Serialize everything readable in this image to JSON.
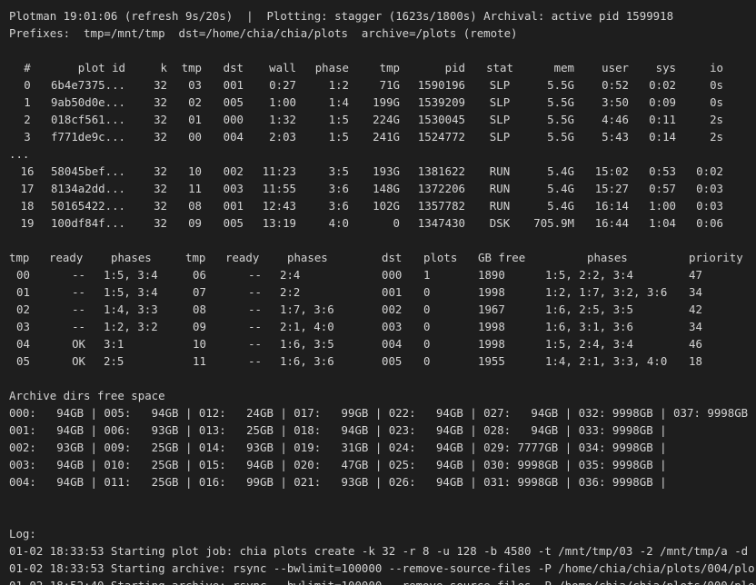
{
  "header": {
    "line1": "Plotman 19:01:06 (refresh 9s/20s)  |  Plotting: stagger (1623s/1800s) Archival: active pid 1599918",
    "line2": "Prefixes:  tmp=/mnt/tmp  dst=/home/chia/chia/plots  archive=/plots (remote)"
  },
  "jobs": {
    "columns": [
      "#",
      "plot id",
      "k",
      "tmp",
      "dst",
      "wall",
      "phase",
      "tmp",
      "pid",
      "stat",
      "mem",
      "user",
      "sys",
      "io"
    ],
    "rows_top": [
      [
        "0",
        "6b4e7375...",
        "32",
        "03",
        "001",
        "0:27",
        "1:2",
        "71G",
        "1590196",
        "SLP",
        "5.5G",
        "0:52",
        "0:02",
        "0s"
      ],
      [
        "1",
        "9ab50d0e...",
        "32",
        "02",
        "005",
        "1:00",
        "1:4",
        "199G",
        "1539209",
        "SLP",
        "5.5G",
        "3:50",
        "0:09",
        "0s"
      ],
      [
        "2",
        "018cf561...",
        "32",
        "01",
        "000",
        "1:32",
        "1:5",
        "224G",
        "1530045",
        "SLP",
        "5.5G",
        "4:46",
        "0:11",
        "2s"
      ],
      [
        "3",
        "f771de9c...",
        "32",
        "00",
        "004",
        "2:03",
        "1:5",
        "241G",
        "1524772",
        "SLP",
        "5.5G",
        "5:43",
        "0:14",
        "2s"
      ]
    ],
    "ellipsis": "...",
    "rows_bottom": [
      [
        "16",
        "58045bef...",
        "32",
        "10",
        "002",
        "11:23",
        "3:5",
        "193G",
        "1381622",
        "RUN",
        "5.4G",
        "15:02",
        "0:53",
        "0:02"
      ],
      [
        "17",
        "8134a2dd...",
        "32",
        "11",
        "003",
        "11:55",
        "3:6",
        "148G",
        "1372206",
        "RUN",
        "5.4G",
        "15:27",
        "0:57",
        "0:03"
      ],
      [
        "18",
        "50165422...",
        "32",
        "08",
        "001",
        "12:43",
        "3:6",
        "102G",
        "1357782",
        "RUN",
        "5.4G",
        "16:14",
        "1:00",
        "0:03"
      ],
      [
        "19",
        "100df84f...",
        "32",
        "09",
        "005",
        "13:19",
        "4:0",
        "0",
        "1347430",
        "DSK",
        "705.9M",
        "16:44",
        "1:04",
        "0:06"
      ]
    ]
  },
  "tmp_dst": {
    "columns": [
      "tmp",
      "ready",
      "phases",
      "tmp",
      "ready",
      "phases",
      "dst",
      "plots",
      "GB free",
      "phases",
      "priority"
    ],
    "rows": [
      [
        "00",
        "--",
        "1:5, 3:4",
        "06",
        "--",
        "2:4",
        "000",
        "1",
        "1890",
        "1:5, 2:2, 3:4",
        "47"
      ],
      [
        "01",
        "--",
        "1:5, 3:4",
        "07",
        "--",
        "2:2",
        "001",
        "0",
        "1998",
        "1:2, 1:7, 3:2, 3:6",
        "34"
      ],
      [
        "02",
        "--",
        "1:4, 3:3",
        "08",
        "--",
        "1:7, 3:6",
        "002",
        "0",
        "1967",
        "1:6, 2:5, 3:5",
        "42"
      ],
      [
        "03",
        "--",
        "1:2, 3:2",
        "09",
        "--",
        "2:1, 4:0",
        "003",
        "0",
        "1998",
        "1:6, 3:1, 3:6",
        "34"
      ],
      [
        "04",
        "OK",
        "3:1",
        "10",
        "--",
        "1:6, 3:5",
        "004",
        "0",
        "1998",
        "1:5, 2:4, 3:4",
        "46"
      ],
      [
        "05",
        "OK",
        "2:5",
        "11",
        "--",
        "1:6, 3:6",
        "005",
        "0",
        "1955",
        "1:4, 2:1, 3:3, 4:0",
        "18"
      ]
    ]
  },
  "archive": {
    "title": "Archive dirs free space",
    "lines": [
      "000:   94GB | 005:   94GB | 012:   24GB | 017:   99GB | 022:   94GB | 027:   94GB | 032: 9998GB | 037: 9998GB",
      "001:   94GB | 006:   93GB | 013:   25GB | 018:   94GB | 023:   94GB | 028:   94GB | 033: 9998GB |",
      "002:   93GB | 009:   25GB | 014:   93GB | 019:   31GB | 024:   94GB | 029: 7777GB | 034: 9998GB |",
      "003:   94GB | 010:   25GB | 015:   94GB | 020:   47GB | 025:   94GB | 030: 9998GB | 035: 9998GB |",
      "004:   94GB | 011:   25GB | 016:   99GB | 021:   93GB | 026:   94GB | 031: 9998GB | 036: 9998GB |"
    ]
  },
  "log": {
    "title": "Log:",
    "lines": [
      "01-02 18:33:53 Starting plot job: chia plots create -k 32 -r 8 -u 128 -b 4580 -t /mnt/tmp/03 -2 /mnt/tmp/a -d",
      "01-02 18:33:53 Starting archive: rsync --bwlimit=100000 --remove-source-files -P /home/chia/chia/plots/004/plo",
      "01-02 18:52:40 Starting archive: rsync --bwlimit=100000 --remove-source-files -P /home/chia/chia/plots/000/plo"
    ]
  }
}
